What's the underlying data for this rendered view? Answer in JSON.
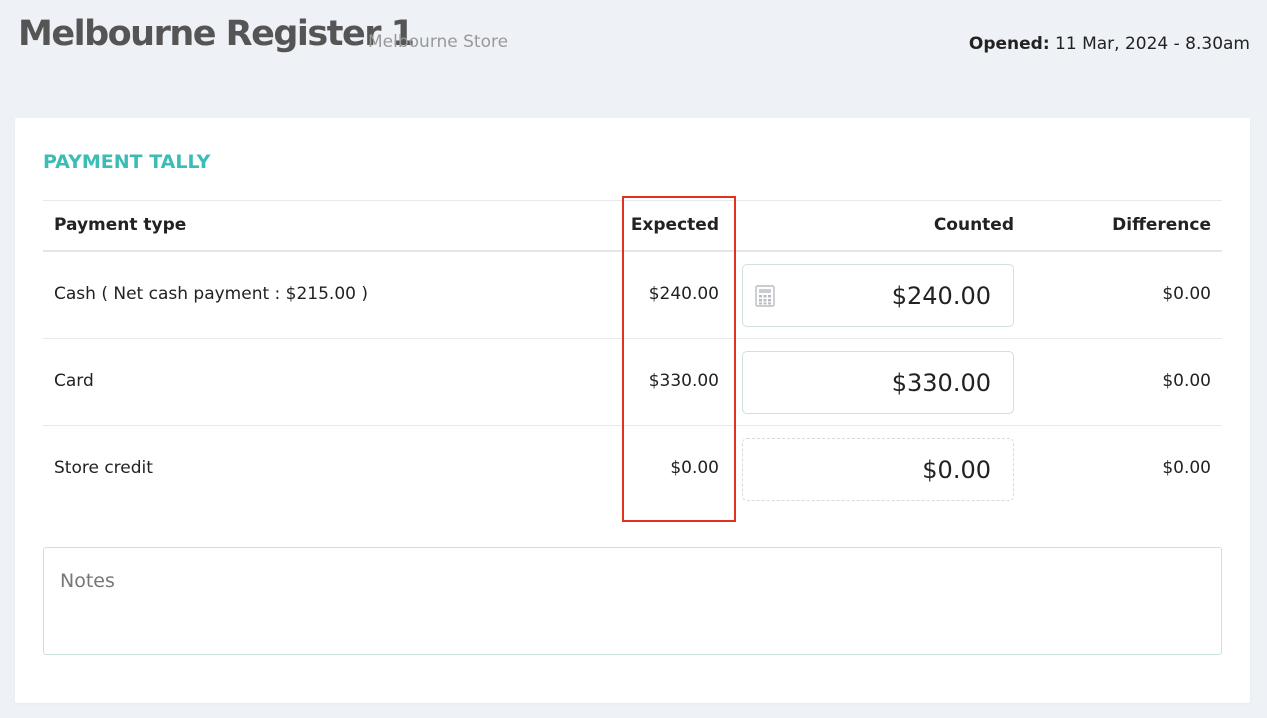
{
  "header": {
    "register_name": "Melbourne Register 1",
    "store_name": "Melbourne Store",
    "opened_label": "Opened:",
    "opened_value": " 11 Mar, 2024 - 8.30am"
  },
  "tally": {
    "title": "PAYMENT TALLY",
    "columns": {
      "payment_type": "Payment type",
      "expected": "Expected",
      "counted": "Counted",
      "difference": "Difference"
    },
    "rows": [
      {
        "payment_type": "Cash ( Net cash payment : $215.00 )",
        "expected": "$240.00",
        "counted": "$240.00",
        "difference": "$0.00",
        "icon": "calculator-icon"
      },
      {
        "payment_type": "Card",
        "expected": "$330.00",
        "counted": "$330.00",
        "difference": "$0.00"
      },
      {
        "payment_type": "Store credit",
        "expected": "$0.00",
        "counted": "$0.00",
        "difference": "$0.00"
      }
    ]
  },
  "notes": {
    "placeholder": "Notes"
  },
  "colors": {
    "accent": "#3bbcb5",
    "highlight": "#e0321f"
  }
}
